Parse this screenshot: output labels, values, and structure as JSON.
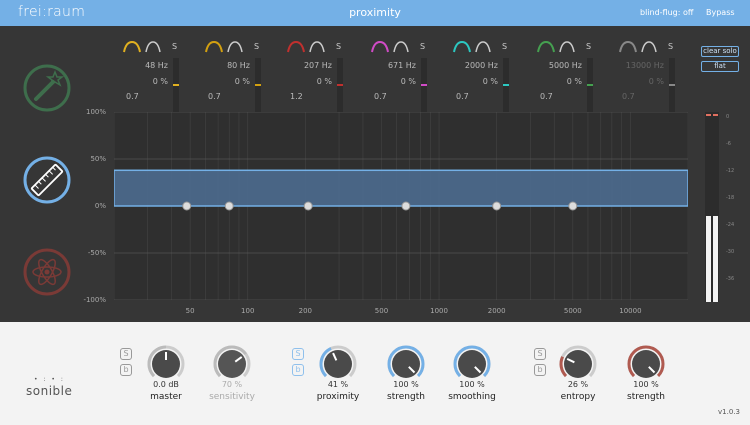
{
  "topbar": {
    "brand": "frei:raum",
    "product": "proximity",
    "blind_flag": "blind-flug: off",
    "bypass": "Bypass"
  },
  "side_buttons": [
    {
      "name": "magic-wand-icon",
      "color": "#3e6e4c"
    },
    {
      "name": "ruler-icon",
      "color": "#74b0e6"
    },
    {
      "name": "atom-icon",
      "color": "#7a3a36"
    }
  ],
  "bands": [
    {
      "freq": "48",
      "unit": "Hz",
      "pct": "0",
      "pct_unit": "%",
      "q": "0.7",
      "solo": "S",
      "color": "#e0b020",
      "active": true
    },
    {
      "freq": "80",
      "unit": "Hz",
      "pct": "0",
      "pct_unit": "%",
      "q": "0.7",
      "solo": "S",
      "color": "#d3a010",
      "active": true
    },
    {
      "freq": "207",
      "unit": "Hz",
      "pct": "0",
      "pct_unit": "%",
      "q": "1.2",
      "solo": "S",
      "color": "#c0302e",
      "active": true
    },
    {
      "freq": "671",
      "unit": "Hz",
      "pct": "0",
      "pct_unit": "%",
      "q": "0.7",
      "solo": "S",
      "color": "#d04bc6",
      "active": true
    },
    {
      "freq": "2000",
      "unit": "Hz",
      "pct": "0",
      "pct_unit": "%",
      "q": "0.7",
      "solo": "S",
      "color": "#2cc7c0",
      "active": true
    },
    {
      "freq": "5000",
      "unit": "Hz",
      "pct": "0",
      "pct_unit": "%",
      "q": "0.7",
      "solo": "S",
      "color": "#45a050",
      "active": true
    },
    {
      "freq": "13000",
      "unit": "Hz",
      "pct": "0",
      "pct_unit": "%",
      "q": "0.7",
      "solo": "S",
      "color": "#888888",
      "active": false
    }
  ],
  "buttons": {
    "clear_solo": "clear solo",
    "flat": "flat"
  },
  "chart_data": {
    "type": "line",
    "y_ticks": [
      "100%",
      "50%",
      "0%",
      "-50%",
      "-100%"
    ],
    "x_ticks": [
      "50",
      "100",
      "200",
      "500",
      "1000",
      "2000",
      "5000",
      "10000"
    ],
    "ylim": [
      -100,
      100
    ],
    "band_nodes": [
      {
        "freq": 48,
        "value": 0
      },
      {
        "freq": 80,
        "value": 0
      },
      {
        "freq": 207,
        "value": 0
      },
      {
        "freq": 671,
        "value": 0
      },
      {
        "freq": 2000,
        "value": 0
      },
      {
        "freq": 5000,
        "value": 0
      }
    ],
    "overall_level": 38
  },
  "vu_labels": [
    "0",
    "-6",
    "-12",
    "-18",
    "-24",
    "-30",
    "-36"
  ],
  "logo": {
    "text": "sonible",
    "dots": "• : • :"
  },
  "version": "v1.0.3",
  "controls": {
    "master": {
      "value": "0.0 dB",
      "label": "master",
      "level": 0.5
    },
    "sensitivity": {
      "value": "70 %",
      "label": "sensitivity",
      "level": 0.7
    },
    "proximity": {
      "value": "41 %",
      "label": "proximity",
      "level": 0.41
    },
    "strength1": {
      "value": "100 %",
      "label": "strength",
      "level": 1.0
    },
    "smoothing": {
      "value": "100 %",
      "label": "smoothing",
      "level": 1.0
    },
    "entropy": {
      "value": "26 %",
      "label": "entropy",
      "level": 0.26
    },
    "strength2": {
      "value": "100 %",
      "label": "strength",
      "level": 1.0
    }
  },
  "sb_labels": {
    "s": "S",
    "b": "b"
  }
}
